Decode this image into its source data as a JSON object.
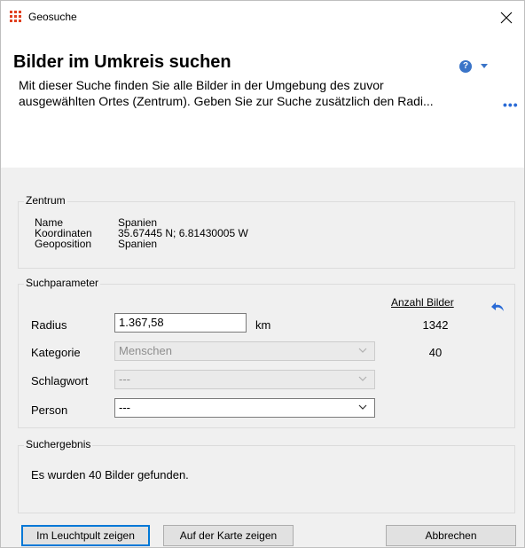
{
  "window": {
    "title": "Geosuche",
    "icon": "app-grid-icon",
    "close_icon": "close-icon"
  },
  "header": {
    "title": "Bilder im Umkreis suchen",
    "description_line1": "Mit dieser Suche finden Sie alle Bilder in der Umgebung des zuvor",
    "description_line2": "ausgewählten Ortes (Zentrum). Geben Sie zur Suche zusätzlich den Radi...",
    "more": "•••",
    "help_icon": "help-icon"
  },
  "zentrum": {
    "legend": "Zentrum",
    "rows": [
      {
        "key": "Name",
        "value": "Spanien"
      },
      {
        "key": "Koordinaten",
        "value": "35.67445 N; 6.81430005 W"
      },
      {
        "key": "Geoposition",
        "value": "Spanien"
      }
    ]
  },
  "suchparameter": {
    "legend": "Suchparameter",
    "count_header": "Anzahl Bilder",
    "radius": {
      "label": "Radius",
      "value": "1.367,58",
      "unit": "km",
      "count": "1342"
    },
    "kategorie": {
      "label": "Kategorie",
      "value": "Menschen",
      "count": "40",
      "enabled": false
    },
    "schlagwort": {
      "label": "Schlagwort",
      "value": "---",
      "enabled": false
    },
    "person": {
      "label": "Person",
      "value": "---",
      "enabled": true
    }
  },
  "suchergebnis": {
    "legend": "Suchergebnis",
    "text": "Es wurden 40 Bilder gefunden."
  },
  "buttons": {
    "leuchtpult": "Im Leuchtpult zeigen",
    "karte": "Auf der Karte zeigen",
    "abbrechen": "Abbrechen"
  },
  "colors": {
    "accent": "#0078d7",
    "icon_orange": "#e0401f",
    "help_blue": "#3a74c8"
  }
}
